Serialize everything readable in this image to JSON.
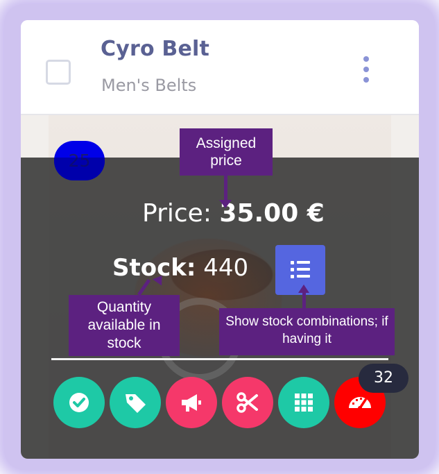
{
  "product": {
    "title": "Cyro Belt",
    "category": "Men's Belts"
  },
  "counter_badge": "25",
  "price": {
    "label": "Price:",
    "value": "35.00 €"
  },
  "stock": {
    "label": "Stock:",
    "value": "440"
  },
  "action_buttons": [
    {
      "icon": "check-circle-icon",
      "color": "#1ec9a6"
    },
    {
      "icon": "tag-icon",
      "color": "#1ec9a6"
    },
    {
      "icon": "megaphone-icon",
      "color": "#f5386a"
    },
    {
      "icon": "scissors-icon",
      "color": "#f5386a"
    },
    {
      "icon": "grid-icon",
      "color": "#1ec9a6"
    },
    {
      "icon": "speedometer-icon",
      "color": "#ff0000"
    }
  ],
  "speed_badge": "32",
  "annotations": {
    "assigned_price": "Assigned price",
    "quantity": "Quantity available in stock",
    "combinations": "Show stock combinations; if having it"
  },
  "colors": {
    "title": "#5a6193",
    "accent_button": "#5566e0",
    "annotation_bg": "#5c2180",
    "overlay": "#3a3a3a"
  }
}
